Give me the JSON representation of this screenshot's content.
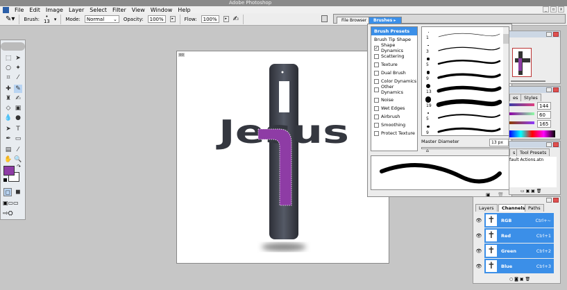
{
  "app": {
    "title": "Adobe Photoshop"
  },
  "menu": [
    "File",
    "Edit",
    "Image",
    "Layer",
    "Select",
    "Filter",
    "View",
    "Window",
    "Help"
  ],
  "options": {
    "brush_label": "Brush:",
    "brush_size": "13",
    "mode_label": "Mode:",
    "mode_value": "Normal",
    "opacity_label": "Opacity:",
    "opacity_value": "100%",
    "flow_label": "Flow:",
    "flow_value": "100%"
  },
  "well": {
    "tabs": [
      "File Browser",
      "Brushes"
    ]
  },
  "brushes": {
    "options": [
      {
        "label": "Brush Presets",
        "checked": null
      },
      {
        "label": "Brush Tip Shape",
        "checked": null
      },
      {
        "label": "Shape Dynamics",
        "checked": true
      },
      {
        "label": "Scattering",
        "checked": false
      },
      {
        "label": "Texture",
        "checked": false
      },
      {
        "label": "Dual Brush",
        "checked": false
      },
      {
        "label": "Color Dynamics",
        "checked": false
      },
      {
        "label": "Other Dynamics",
        "checked": false
      },
      {
        "label": "Noise",
        "checked": false
      },
      {
        "label": "Wet Edges",
        "checked": false
      },
      {
        "label": "Airbrush",
        "checked": false
      },
      {
        "label": "Smoothing",
        "checked": false
      },
      {
        "label": "Protect Texture",
        "checked": false
      }
    ],
    "presets": [
      "1",
      "3",
      "5",
      "9",
      "13",
      "19",
      "5",
      "9"
    ],
    "master_diameter_label": "Master Diameter",
    "master_diameter_value": "13 px"
  },
  "color": {
    "tabs": [
      "es",
      "Styles"
    ],
    "values": [
      "144",
      "60",
      "165"
    ],
    "foreground": "#8e3ca5"
  },
  "actions": {
    "tabs": [
      "s",
      "Tool Presets"
    ],
    "item": "fault Actions.atn"
  },
  "channels": {
    "tabs": [
      "Layers",
      "Channels",
      "Paths"
    ],
    "rows": [
      {
        "name": "RGB",
        "shortcut": "Ctrl+~"
      },
      {
        "name": "Red",
        "shortcut": "Ctrl+1"
      },
      {
        "name": "Green",
        "shortcut": "Ctrl+2"
      },
      {
        "name": "Blue",
        "shortcut": "Ctrl+3"
      }
    ]
  },
  "canvas": {
    "text": "Jesus",
    "accent": "#8e3ca5"
  }
}
